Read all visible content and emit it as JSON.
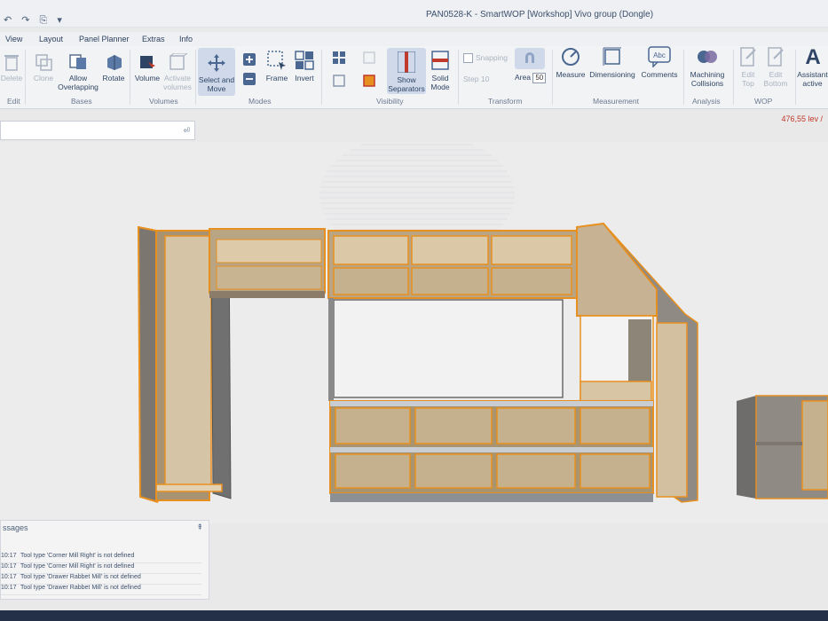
{
  "window": {
    "title": "PAN0528-K - SmartWOP [Workshop] Vivo group (Dongle)"
  },
  "menu": [
    "View",
    "Layout",
    "Panel Planner",
    "Extras",
    "Info"
  ],
  "ribbon": {
    "delete": "Delete",
    "clone": "Clone",
    "allow_overlapping": "Allow Overlapping",
    "rotate": "Rotate",
    "volume": "Volume",
    "activate_volumes": "Activate volumes",
    "select_and_move": "Select and Move",
    "frame": "Frame",
    "invert": "Invert",
    "show_separators": "Show Separators",
    "solid_mode": "Solid Mode",
    "snapping": "Snapping",
    "step_label": "Step",
    "step_value": "10",
    "area_label": "Area",
    "area_value": "50",
    "measure": "Measure",
    "dimensioning": "Dimensioning",
    "comments": "Comments",
    "machining_collisions": "Machining Collisions",
    "edit_top": "Edit Top",
    "edit_bottom": "Edit Bottom",
    "assistant": "Assistant active",
    "groups": {
      "edit": "Edit",
      "bases": "Bases",
      "volumes": "Volumes",
      "modes": "Modes",
      "visibility": "Visibility",
      "transform": "Transform",
      "measurement": "Measurement",
      "analysis": "Analysis",
      "wop": "WOP"
    }
  },
  "price": "476,55 lev /",
  "messages": {
    "title": "ssages",
    "rows": [
      {
        "time": "10:17",
        "text": "Tool type 'Corner Mill Right' is not defined"
      },
      {
        "time": "10:17",
        "text": "Tool type 'Corner Mill Right' is not defined"
      },
      {
        "time": "10:17",
        "text": "Tool type 'Drawer Rabbet Mill' is not defined"
      },
      {
        "time": "10:17",
        "text": "Tool type 'Drawer Rabbet Mill' is not defined"
      }
    ]
  },
  "colors": {
    "edge": "#e8901f",
    "panel": "#cdb898",
    "inner": "#b8a485",
    "side": "#6b6b6b",
    "accent": "#5c7aa8"
  }
}
